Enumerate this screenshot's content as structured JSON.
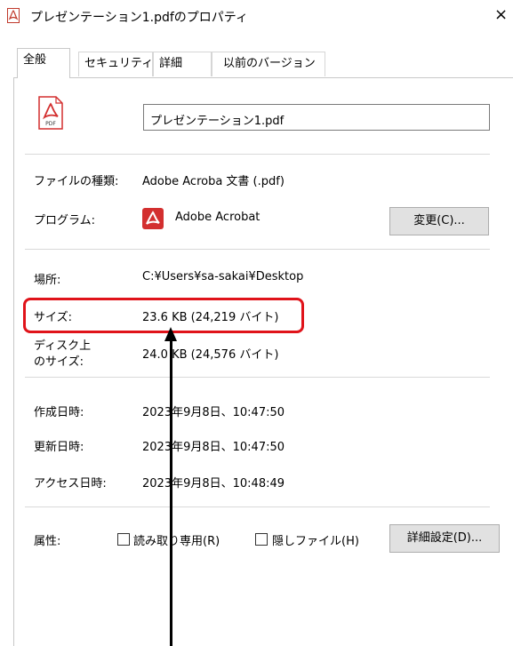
{
  "window": {
    "title": "プレゼンテーション1.pdfのプロパティ",
    "close_glyph": "×"
  },
  "tabs": [
    {
      "label": "全般",
      "active": true
    },
    {
      "label": "セキュリティ"
    },
    {
      "label": "詳細"
    },
    {
      "label": "以前のバージョン"
    }
  ],
  "file": {
    "name": "プレゼンテーション1.pdf",
    "icon": "pdf-file-icon",
    "icon_label": "PDF"
  },
  "properties": {
    "type_label": "ファイルの種類:",
    "type_value": "Adobe Acroba 文書 (.pdf)",
    "program_label": "プログラム:",
    "program_value": "Adobe Acrobat",
    "program_icon": "acrobat-icon",
    "change_button": "変更(C)...",
    "location_label": "場所:",
    "location_value": "C:¥Users¥sa-sakai¥Desktop",
    "size_label": "サイズ:",
    "size_value": "23.6 KB (24,219 バイト)",
    "disk_size_label_1": "ディスク上",
    "disk_size_label_2": "のサイズ:",
    "disk_size_value": "24.0 KB (24,576 バイト)",
    "created_label": "作成日時:",
    "created_value": "2023年9月8日、10:47:50",
    "modified_label": "更新日時:",
    "modified_value": "2023年9月8日、10:47:50",
    "accessed_label": "アクセス日時:",
    "accessed_value": "2023年9月8日、10:48:49"
  },
  "attributes": {
    "label": "属性:",
    "readonly_label": "読み取り専用(R)",
    "readonly_checked": false,
    "hidden_label": "隠しファイル(H)",
    "hidden_checked": false,
    "advanced_button": "詳細設定(D)..."
  },
  "colors": {
    "highlight": "#e0131a",
    "pdf_red": "#d32f2f",
    "button_bg": "#e1e1e1"
  }
}
